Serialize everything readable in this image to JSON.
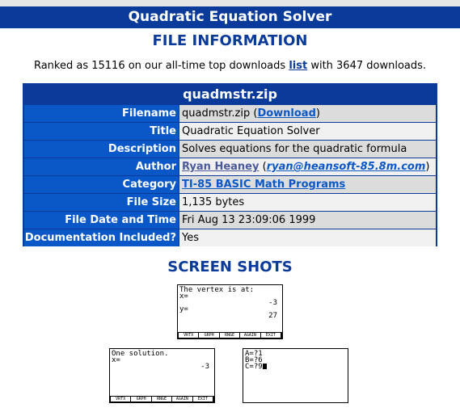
{
  "header": {
    "title": "Quadratic Equation Solver"
  },
  "file_info": {
    "heading": "FILE INFORMATION",
    "ranked_prefix": "Ranked as 15116 on our all-time top downloads ",
    "ranked_link": "list",
    "ranked_suffix": " with 3647 downloads.",
    "table_title": "quadmstr.zip",
    "rows": {
      "filename": {
        "label": "Filename",
        "value": "quadmstr.zip",
        "open_paren": " (",
        "link": "Download",
        "close_paren": ")"
      },
      "title": {
        "label": "Title",
        "value": "Quadratic Equation Solver"
      },
      "description": {
        "label": "Description",
        "value": "Solves equations for the quadratic formula"
      },
      "author": {
        "label": "Author",
        "name": "Ryan Heaney",
        "open_paren": " (",
        "email": "ryan@heansoft-85.8m.com",
        "close_paren": ")"
      },
      "category": {
        "label": "Category",
        "link": "TI-85 BASIC Math Programs"
      },
      "file_size": {
        "label": "File Size",
        "value": "1,135 bytes"
      },
      "file_date": {
        "label": "File Date and Time",
        "value": "Fri Aug 13 23:09:06 1999"
      },
      "documentation": {
        "label": "Documentation Included?",
        "value": "Yes"
      }
    }
  },
  "screenshots": {
    "heading": "SCREEN SHOTS",
    "shot1": {
      "line1": "The vertex is at:",
      "line2": "x=",
      "val2": "-3",
      "line3": "y=",
      "val3": "27"
    },
    "shot2": {
      "line1": "One solution.",
      "line2": "x=",
      "val2": "-3"
    },
    "shot3": {
      "line1": "A=?1",
      "line2": "B=?6",
      "line3": "C=?9"
    },
    "softkeys": [
      "VRTX",
      "GRPH",
      "RNGE",
      "AGAIN",
      "EXIT"
    ]
  },
  "colors": {
    "banner": "#0a3a9a",
    "label_cell": "#0a58c8",
    "row_alt_1": "#dcdcdc",
    "row_alt_2": "#f0f0f0",
    "link": "#0a58c8"
  }
}
